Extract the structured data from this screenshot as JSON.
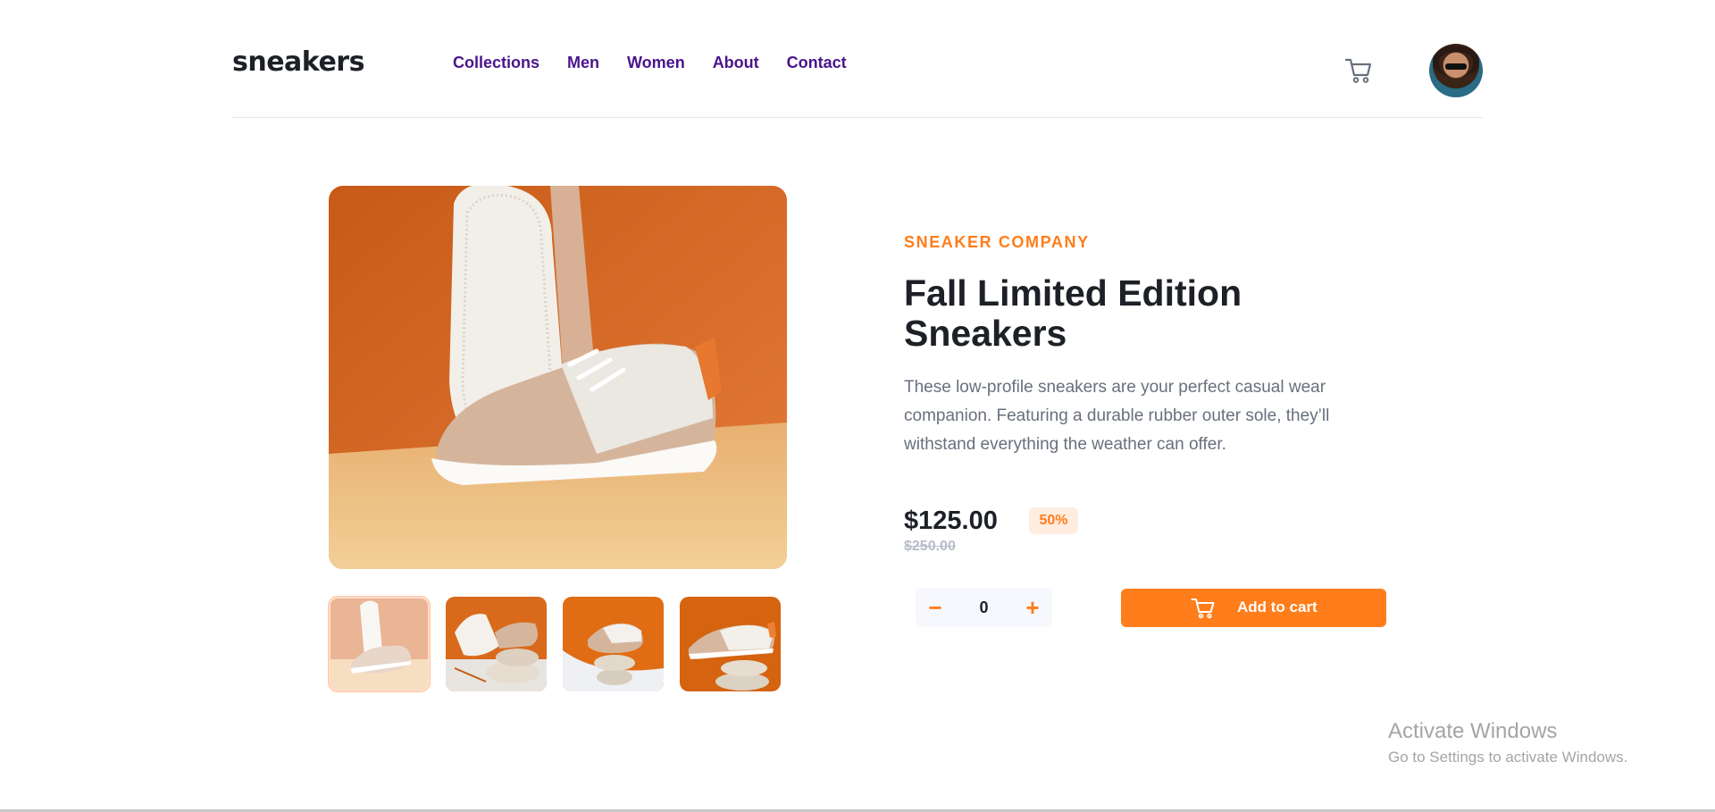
{
  "header": {
    "logo": "sneakers",
    "nav": [
      "Collections",
      "Men",
      "Women",
      "About",
      "Contact"
    ]
  },
  "icons": {
    "cart": "cart-icon",
    "avatar": "avatar",
    "minus": "minus-icon",
    "plus": "plus-icon"
  },
  "product": {
    "company": "SNEAKER COMPANY",
    "title": "Fall Limited Edition Sneakers",
    "description": "These low-profile sneakers are your perfect casual wear companion. Featuring a durable rubber outer sole, they’ll withstand everything the weather can offer.",
    "price": "$125.00",
    "discount": "50%",
    "old_price": "$250.00",
    "quantity": "0",
    "minus_label": "−",
    "plus_label": "+",
    "add_to_cart": "Add to cart"
  },
  "gallery": {
    "active_thumbnail": 1,
    "thumbnail_count": 4
  },
  "colors": {
    "accent": "#ff7d1a",
    "accent_light": "#ffede0",
    "nav": "#4a148c",
    "text_dark": "#1d2026",
    "text_muted": "#68707d"
  },
  "watermark": {
    "title": "Activate Windows",
    "subtitle": "Go to Settings to activate Windows."
  }
}
